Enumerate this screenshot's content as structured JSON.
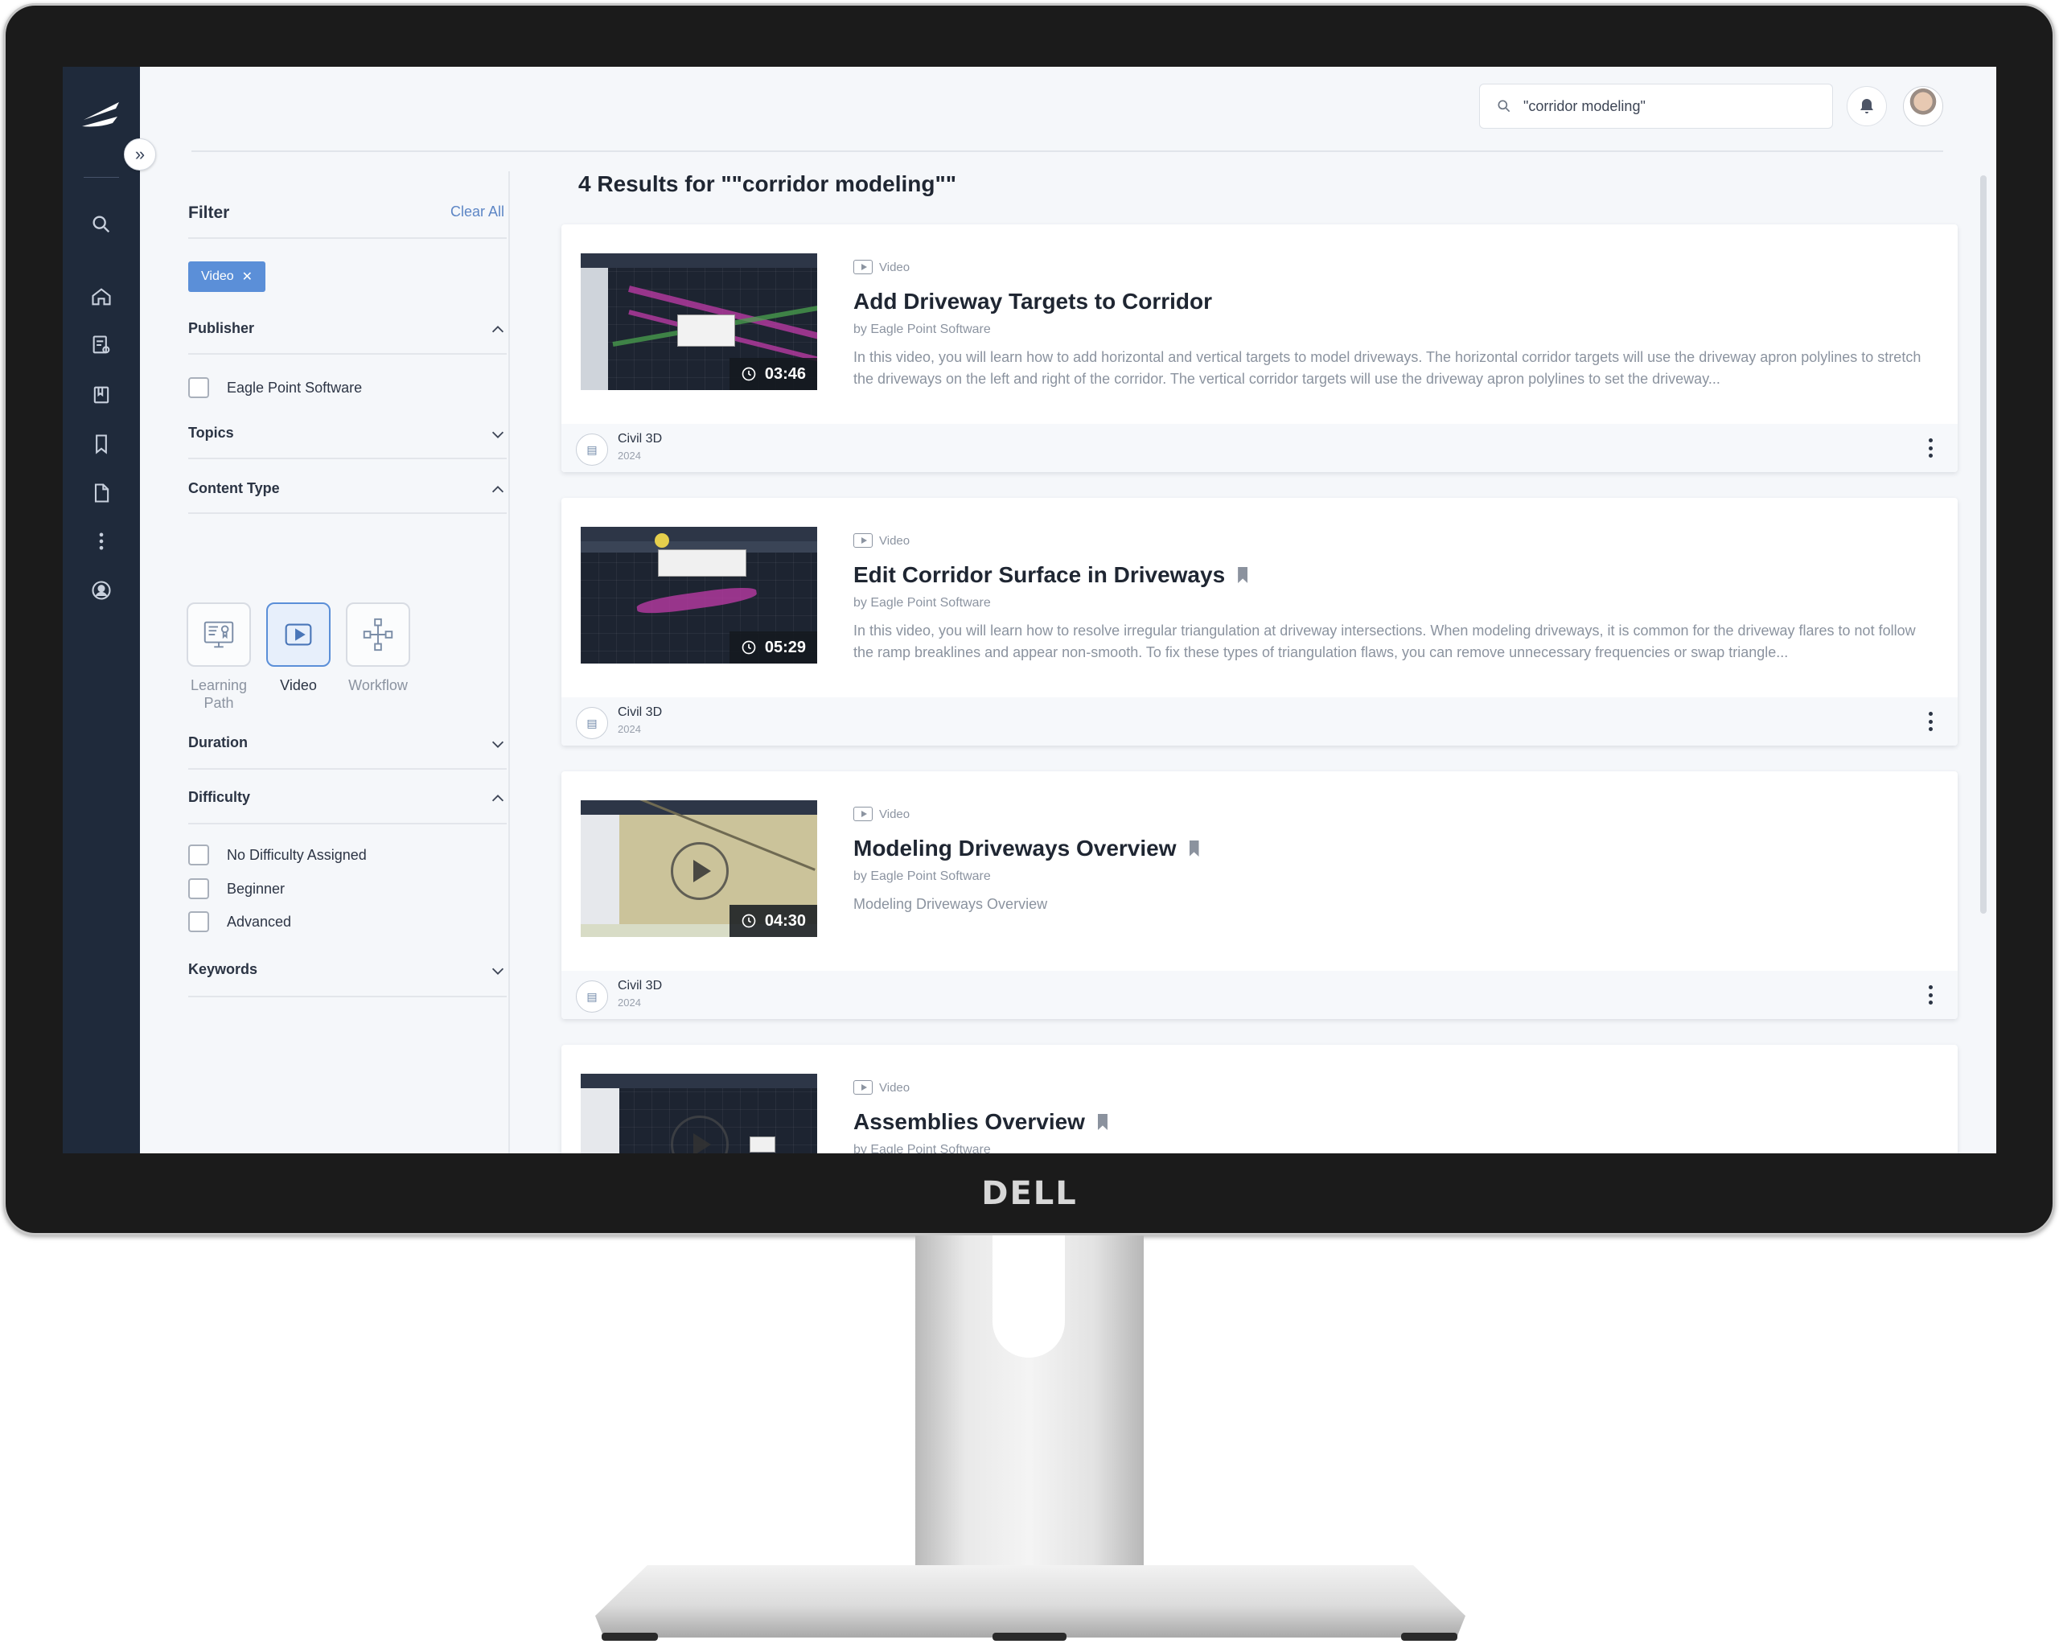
{
  "brand": {
    "monitor_logo": "DELL"
  },
  "search": {
    "value": "\"corridor modeling\""
  },
  "filter": {
    "title": "Filter",
    "clear_all": "Clear All",
    "active_chip": "Video",
    "publisher": {
      "title": "Publisher",
      "options": [
        "Eagle Point Software"
      ]
    },
    "topics": {
      "title": "Topics"
    },
    "content_type": {
      "title": "Content Type",
      "options": [
        {
          "label": "Learning Path",
          "selected": false
        },
        {
          "label": "Video",
          "selected": true
        },
        {
          "label": "Workflow",
          "selected": false
        }
      ]
    },
    "duration": {
      "title": "Duration"
    },
    "difficulty": {
      "title": "Difficulty",
      "options": [
        "No Difficulty Assigned",
        "Beginner",
        "Advanced"
      ]
    },
    "keywords": {
      "title": "Keywords"
    }
  },
  "results": {
    "heading": "4 Results for \"\"corridor modeling\"\"",
    "items": [
      {
        "type": "Video",
        "title": "Add Driveway Targets to Corridor",
        "by": "by Eagle Point Software",
        "description": "In this video, you will learn how to add horizontal and vertical targets to model driveways. The horizontal corridor targets will use the driveway apron polylines to stretch the driveways on the left and right of the corridor. The vertical corridor targets will use the driveway apron polylines to set the driveway...",
        "duration": "03:46",
        "app": "Civil 3D",
        "year": "2024",
        "bookmarked": false
      },
      {
        "type": "Video",
        "title": "Edit Corridor Surface in Driveways",
        "by": "by Eagle Point Software",
        "description": "In this video, you will learn how to resolve irregular triangulation at driveway intersections. When modeling driveways, it is common for the driveway flares to not follow the ramp breaklines and appear non-smooth. To fix these types of triangulation flaws, you can remove unnecessary frequencies or swap triangle...",
        "duration": "05:29",
        "app": "Civil 3D",
        "year": "2024",
        "bookmarked": true
      },
      {
        "type": "Video",
        "title": "Modeling Driveways Overview",
        "by": "by Eagle Point Software",
        "description": "Modeling Driveways Overview",
        "duration": "04:30",
        "app": "Civil 3D",
        "year": "2024",
        "bookmarked": true
      },
      {
        "type": "Video",
        "title": "Assemblies Overview",
        "by": "by Eagle Point Software",
        "bookmarked": true
      }
    ]
  },
  "colors": {
    "accent": "#5b8fd8",
    "rail": "#1f2a3b",
    "background": "#f5f7fa"
  }
}
